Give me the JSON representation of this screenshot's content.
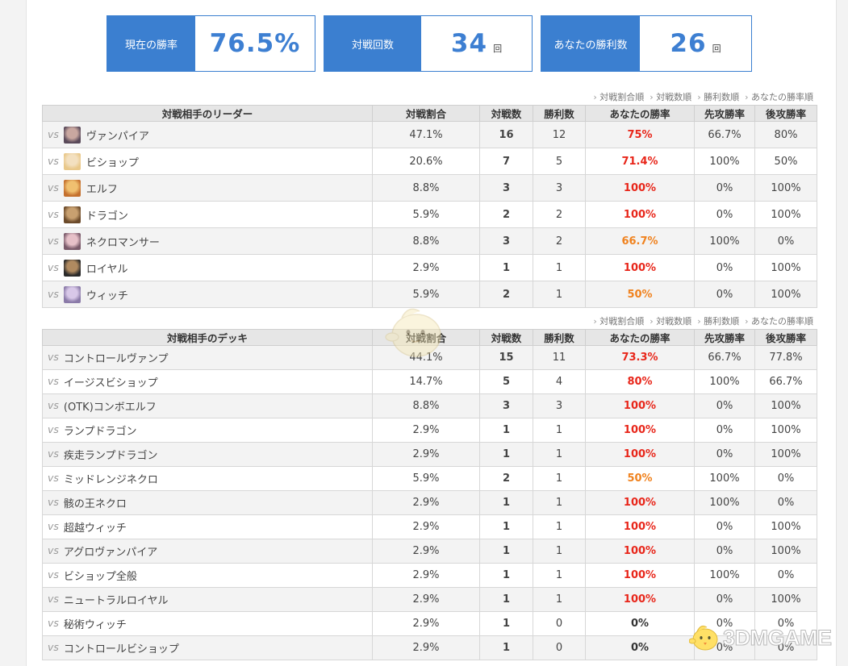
{
  "stats": [
    {
      "label": "現在の勝率",
      "value": "76.5%",
      "unit": ""
    },
    {
      "label": "対戦回数",
      "value": "34",
      "unit": "回"
    },
    {
      "label": "あなたの勝利数",
      "value": "26",
      "unit": "回"
    }
  ],
  "sort_links": [
    "対戦割合順",
    "対戦数順",
    "勝利数順",
    "あなたの勝率順"
  ],
  "vs_label": "vs",
  "leader_table": {
    "headers": [
      "対戦相手のリーダー",
      "対戦割合",
      "対戦数",
      "勝利数",
      "あなたの勝率",
      "先攻勝率",
      "後攻勝率"
    ],
    "rows": [
      {
        "name": "ヴァンパイア",
        "avatar": "vampire-portrait",
        "share": "47.1%",
        "matches": "16",
        "wins": "12",
        "winrate": "75%",
        "rate_color": "#e8261a",
        "first": "66.7%",
        "second": "80%"
      },
      {
        "name": "ビショップ",
        "avatar": "bishop-portrait",
        "share": "20.6%",
        "matches": "7",
        "wins": "5",
        "winrate": "71.4%",
        "rate_color": "#e8261a",
        "first": "100%",
        "second": "50%"
      },
      {
        "name": "エルフ",
        "avatar": "elf-portrait",
        "share": "8.8%",
        "matches": "3",
        "wins": "3",
        "winrate": "100%",
        "rate_color": "#e8261a",
        "first": "0%",
        "second": "100%"
      },
      {
        "name": "ドラゴン",
        "avatar": "dragon-portrait",
        "share": "5.9%",
        "matches": "2",
        "wins": "2",
        "winrate": "100%",
        "rate_color": "#e8261a",
        "first": "0%",
        "second": "100%"
      },
      {
        "name": "ネクロマンサー",
        "avatar": "necromancer-portrait",
        "share": "8.8%",
        "matches": "3",
        "wins": "2",
        "winrate": "66.7%",
        "rate_color": "#f0821e",
        "first": "100%",
        "second": "0%"
      },
      {
        "name": "ロイヤル",
        "avatar": "royal-portrait",
        "share": "2.9%",
        "matches": "1",
        "wins": "1",
        "winrate": "100%",
        "rate_color": "#e8261a",
        "first": "0%",
        "second": "100%"
      },
      {
        "name": "ウィッチ",
        "avatar": "witch-portrait",
        "share": "5.9%",
        "matches": "2",
        "wins": "1",
        "winrate": "50%",
        "rate_color": "#f0821e",
        "first": "0%",
        "second": "100%"
      }
    ]
  },
  "deck_table": {
    "headers": [
      "対戦相手のデッキ",
      "対戦割合",
      "対戦数",
      "勝利数",
      "あなたの勝率",
      "先攻勝率",
      "後攻勝率"
    ],
    "rows": [
      {
        "name": "コントロールヴァンプ",
        "share": "44.1%",
        "matches": "15",
        "wins": "11",
        "winrate": "73.3%",
        "rate_color": "#e8261a",
        "first": "66.7%",
        "second": "77.8%"
      },
      {
        "name": "イージスビショップ",
        "share": "14.7%",
        "matches": "5",
        "wins": "4",
        "winrate": "80%",
        "rate_color": "#e8261a",
        "first": "100%",
        "second": "66.7%"
      },
      {
        "name": "(OTK)コンボエルフ",
        "share": "8.8%",
        "matches": "3",
        "wins": "3",
        "winrate": "100%",
        "rate_color": "#e8261a",
        "first": "0%",
        "second": "100%"
      },
      {
        "name": "ランプドラゴン",
        "share": "2.9%",
        "matches": "1",
        "wins": "1",
        "winrate": "100%",
        "rate_color": "#e8261a",
        "first": "0%",
        "second": "100%"
      },
      {
        "name": "疾走ランプドラゴン",
        "share": "2.9%",
        "matches": "1",
        "wins": "1",
        "winrate": "100%",
        "rate_color": "#e8261a",
        "first": "0%",
        "second": "100%"
      },
      {
        "name": "ミッドレンジネクロ",
        "share": "5.9%",
        "matches": "2",
        "wins": "1",
        "winrate": "50%",
        "rate_color": "#f0821e",
        "first": "100%",
        "second": "0%"
      },
      {
        "name": "骸の王ネクロ",
        "share": "2.9%",
        "matches": "1",
        "wins": "1",
        "winrate": "100%",
        "rate_color": "#e8261a",
        "first": "100%",
        "second": "0%"
      },
      {
        "name": "超越ウィッチ",
        "share": "2.9%",
        "matches": "1",
        "wins": "1",
        "winrate": "100%",
        "rate_color": "#e8261a",
        "first": "0%",
        "second": "100%"
      },
      {
        "name": "アグロヴァンパイア",
        "share": "2.9%",
        "matches": "1",
        "wins": "1",
        "winrate": "100%",
        "rate_color": "#e8261a",
        "first": "0%",
        "second": "100%"
      },
      {
        "name": "ビショップ全般",
        "share": "2.9%",
        "matches": "1",
        "wins": "1",
        "winrate": "100%",
        "rate_color": "#e8261a",
        "first": "100%",
        "second": "0%"
      },
      {
        "name": "ニュートラルロイヤル",
        "share": "2.9%",
        "matches": "1",
        "wins": "1",
        "winrate": "100%",
        "rate_color": "#e8261a",
        "first": "0%",
        "second": "100%"
      },
      {
        "name": "秘術ウィッチ",
        "share": "2.9%",
        "matches": "1",
        "wins": "0",
        "winrate": "0%",
        "rate_color": "#333333",
        "first": "0%",
        "second": "0%"
      },
      {
        "name": "コントロールビショップ",
        "share": "2.9%",
        "matches": "1",
        "wins": "0",
        "winrate": "0%",
        "rate_color": "#333333",
        "first": "0%",
        "second": "0%"
      }
    ]
  },
  "watermark": {
    "text": "3DMGAME",
    "logo": "mascot-chick-logo"
  }
}
